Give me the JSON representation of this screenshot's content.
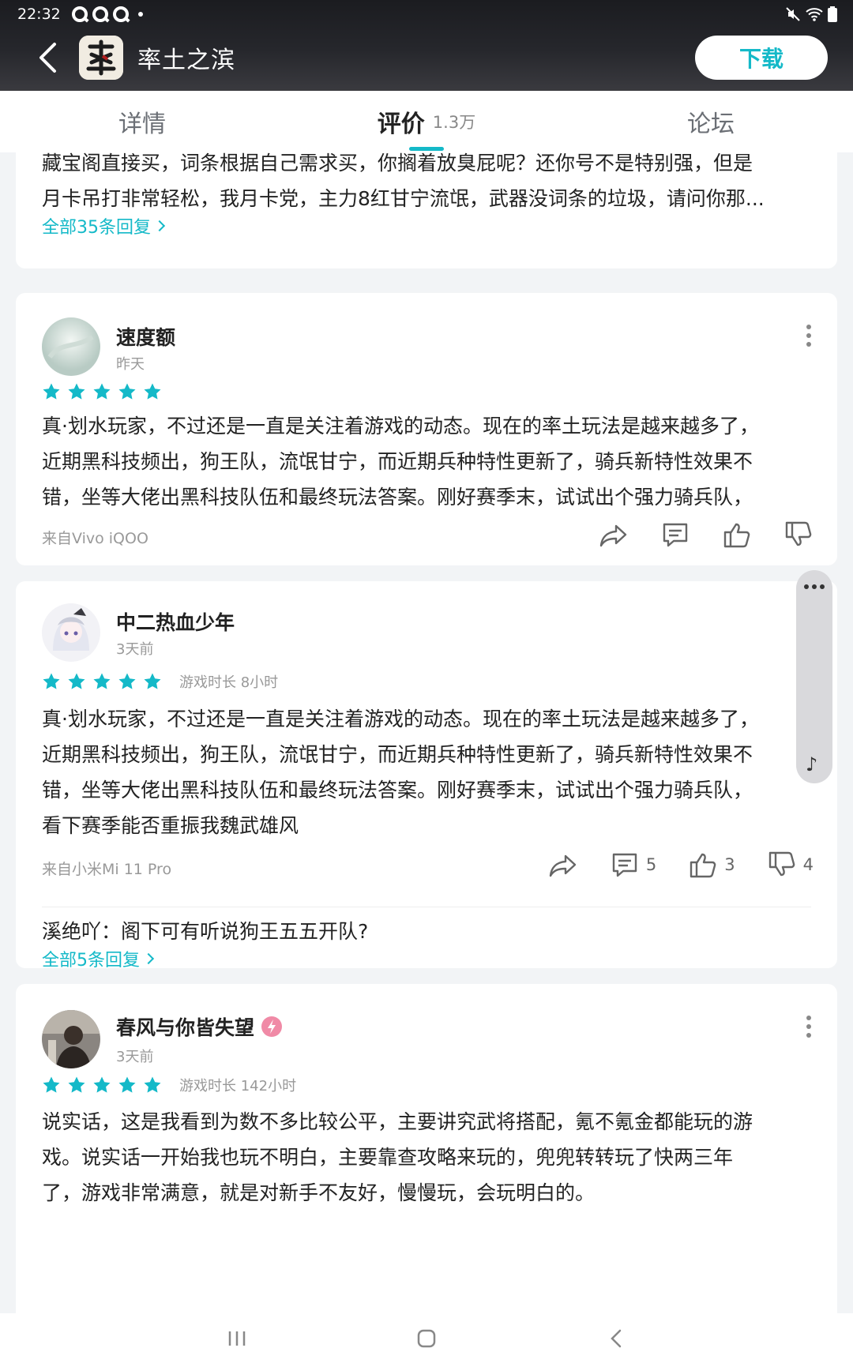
{
  "status_bar": {
    "time": "22:32"
  },
  "header": {
    "app_title": "率土之滨",
    "download_label": "下载"
  },
  "tabs": [
    {
      "label": "详情"
    },
    {
      "label": "评价",
      "count": "1.3万"
    },
    {
      "label": "论坛"
    }
  ],
  "partial_review": {
    "line1": "藏宝阁直接买，词条根据自己需求买，你搁着放臭屁呢？还你号不是特别强，但是",
    "line2": "月卡吊打非常轻松，我月卡党，主力8红甘宁流氓，武器没词条的垃圾，请问你那...",
    "all_replies": "全部35条回复"
  },
  "reviews": [
    {
      "username": "速度额",
      "time": "昨天",
      "stars": 5,
      "lines": [
        "真·划水玩家，不过还是一直是关注着游戏的动态。现在的率土玩法是越来越多了，",
        "近期黑科技频出，狗王队，流氓甘宁，而近期兵种特性更新了，骑兵新特性效果不",
        "错，坐等大佬出黑科技队伍和最终玩法答案。刚好赛季末，试试出个强力骑兵队，"
      ],
      "device": "来自Vivo iQOO"
    },
    {
      "username": "中二热血少年",
      "time": "3天前",
      "stars": 5,
      "playtime": "游戏时长 8小时",
      "lines": [
        "真·划水玩家，不过还是一直是关注着游戏的动态。现在的率土玩法是越来越多了，",
        "近期黑科技频出，狗王队，流氓甘宁，而近期兵种特性更新了，骑兵新特性效果不",
        "错，坐等大佬出黑科技队伍和最终玩法答案。刚好赛季末，试试出个强力骑兵队，",
        "看下赛季能否重振我魏武雄风"
      ],
      "device": "来自小米Mi 11 Pro",
      "comments": "5",
      "likes": "3",
      "dislikes": "4",
      "reply": "溪绝吖：阁下可有听说狗王五五开队?",
      "all_replies": "全部5条回复"
    },
    {
      "username": "春风与你皆失望",
      "time": "3天前",
      "stars": 5,
      "playtime": "游戏时长 142小时",
      "lines": [
        "说实话，这是我看到为数不多比较公平，主要讲究武将搭配，氪不氪金都能玩的游",
        "戏。说实话一开始我也玩不明白，主要靠查攻略来玩的，兜兜转转玩了快两三年",
        "了，游戏非常满意，就是对新手不友好，慢慢玩，会玩明白的。"
      ]
    }
  ],
  "colors": {
    "accent": "#14b9c8",
    "header_bg": "#1b1c20",
    "page_bg": "#f2f4f6"
  }
}
